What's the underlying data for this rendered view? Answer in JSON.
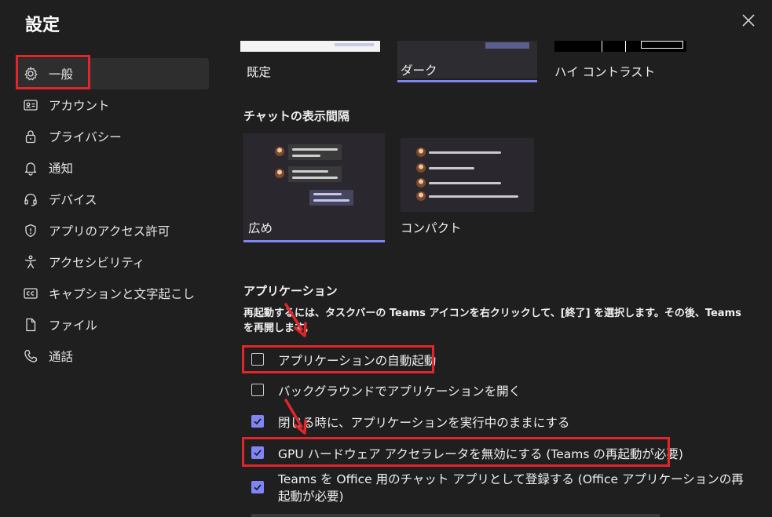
{
  "header": {
    "title": "設定"
  },
  "sidebar": {
    "items": [
      {
        "label": "一般",
        "icon": "gear-icon"
      },
      {
        "label": "アカウント",
        "icon": "id-card-icon"
      },
      {
        "label": "プライバシー",
        "icon": "lock-icon"
      },
      {
        "label": "通知",
        "icon": "bell-icon"
      },
      {
        "label": "デバイス",
        "icon": "headset-icon"
      },
      {
        "label": "アプリのアクセス許可",
        "icon": "shield-icon"
      },
      {
        "label": "アクセシビリティ",
        "icon": "accessibility-icon"
      },
      {
        "label": "キャプションと文字起こし",
        "icon": "cc-icon"
      },
      {
        "label": "ファイル",
        "icon": "file-icon"
      },
      {
        "label": "通話",
        "icon": "phone-icon"
      }
    ]
  },
  "themes": {
    "options": [
      {
        "label": "既定",
        "selected": false
      },
      {
        "label": "ダーク",
        "selected": true
      },
      {
        "label": "ハイ コントラスト",
        "selected": false
      }
    ]
  },
  "chat_density": {
    "heading": "チャットの表示間隔",
    "options": [
      {
        "label": "広め",
        "selected": true
      },
      {
        "label": "コンパクト",
        "selected": false
      }
    ]
  },
  "application": {
    "heading": "アプリケーション",
    "description": "再起動するには、タスクバーの Teams アイコンを右クリックして、[終了] を選択します。その後、Teams を再開します。",
    "options": [
      {
        "label": "アプリケーションの自動起動",
        "checked": false
      },
      {
        "label": "バックグラウンドでアプリケーションを開く",
        "checked": false
      },
      {
        "label": "閉じる時に、アプリケーションを実行中のままにする",
        "checked": true
      },
      {
        "label": "GPU ハードウェア アクセラレータを無効にする (Teams の再起動が必要)",
        "checked": true
      },
      {
        "label": "Teams を Office 用のチャット アプリとして登録する (Office アプリケーションの再起動が必要)",
        "checked": true
      }
    ]
  },
  "colors": {
    "accent": "#7f85f5",
    "highlight": "#e0262b",
    "background": "#1f1f1f"
  }
}
